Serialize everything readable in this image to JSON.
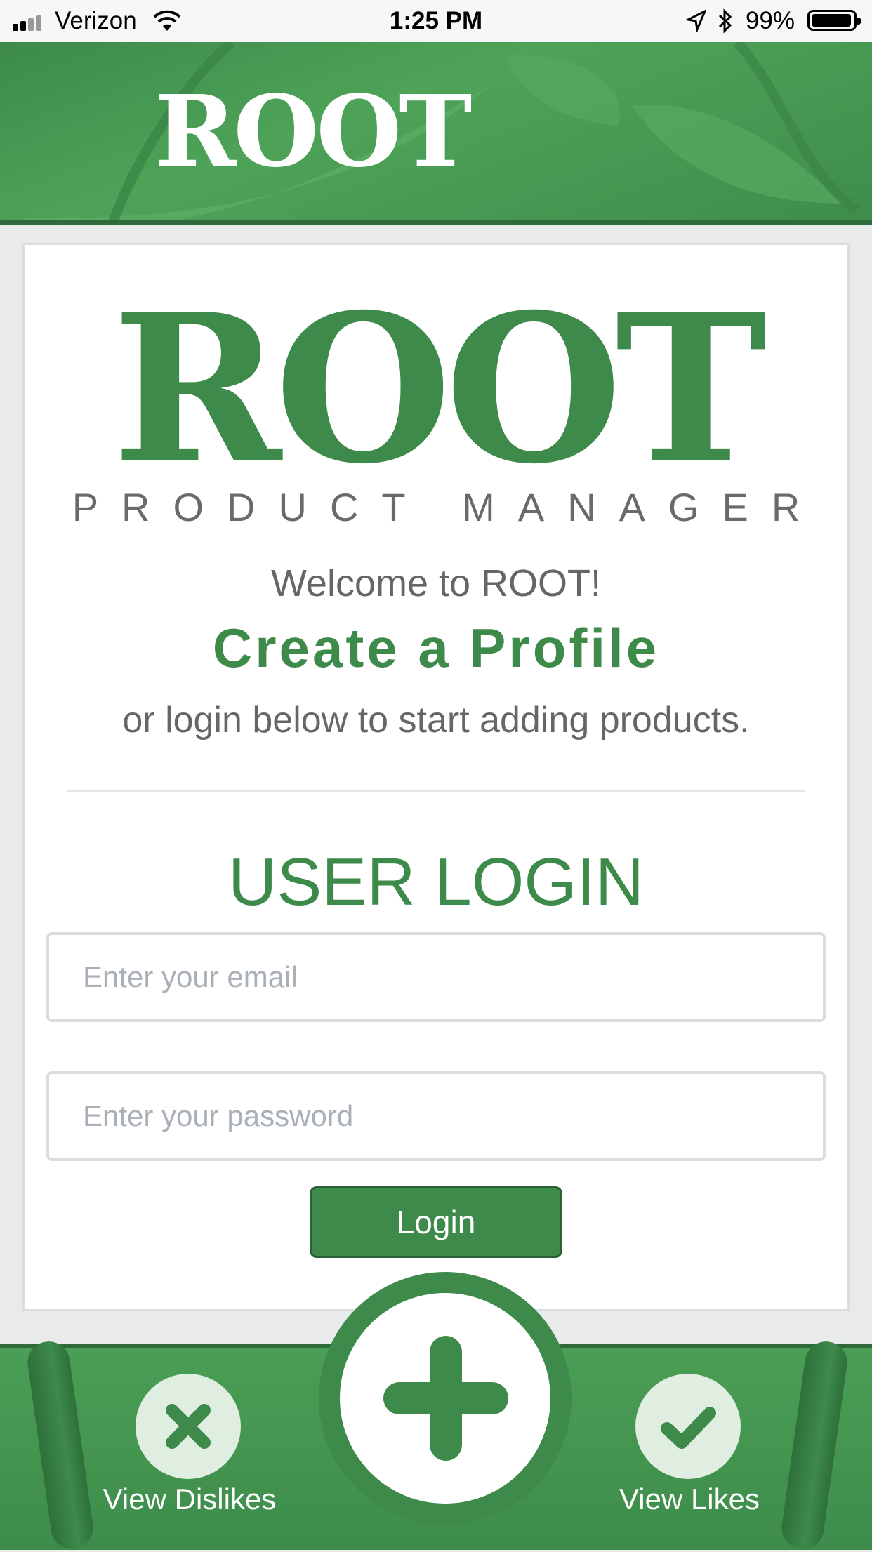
{
  "status_bar": {
    "carrier": "Verizon",
    "time": "1:25 PM",
    "battery": "99%"
  },
  "header": {
    "logo": "ROOT"
  },
  "card": {
    "logo": "ROOT",
    "logo_subtitle": "PRODUCT MANAGER",
    "welcome": "Welcome to ROOT!",
    "create_profile": "Create a Profile",
    "login_prompt": "or login below to start adding products.",
    "section_title": "USER LOGIN",
    "email_placeholder": "Enter your email",
    "password_placeholder": "Enter your password",
    "login_button": "Login"
  },
  "footer": {
    "dislikes_label": "View Dislikes",
    "likes_label": "View Likes"
  },
  "colors": {
    "brand_green": "#3d8a4a",
    "text_gray": "#666666"
  }
}
